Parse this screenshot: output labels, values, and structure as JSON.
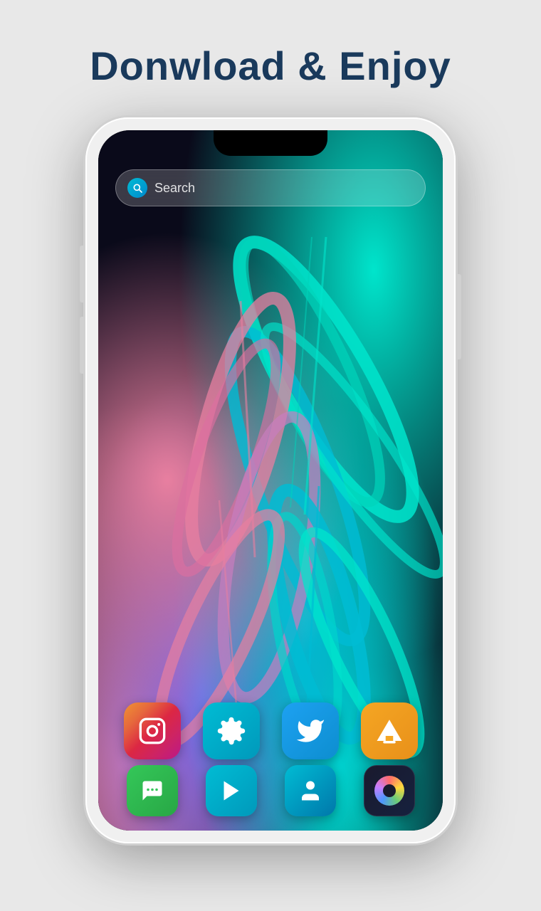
{
  "header": {
    "title": "Donwload & Enjoy"
  },
  "search": {
    "placeholder": "Search"
  },
  "dock_row1": [
    {
      "name": "Instagram",
      "icon_class": "icon-instagram",
      "icon_type": "instagram"
    },
    {
      "name": "Settings",
      "icon_class": "icon-settings",
      "icon_type": "settings"
    },
    {
      "name": "Twitter",
      "icon_class": "icon-twitter",
      "icon_type": "twitter"
    },
    {
      "name": "VLC",
      "icon_class": "icon-vlc",
      "icon_type": "vlc"
    }
  ],
  "dock_row2": [
    {
      "name": "Messages",
      "icon_class": "icon-messages",
      "icon_type": "messages"
    },
    {
      "name": "Play Store",
      "icon_class": "icon-playstore",
      "icon_type": "playstore"
    },
    {
      "name": "Contacts",
      "icon_class": "icon-contacts",
      "icon_type": "contacts"
    },
    {
      "name": "Camera",
      "icon_class": "icon-camera",
      "icon_type": "camera"
    }
  ]
}
